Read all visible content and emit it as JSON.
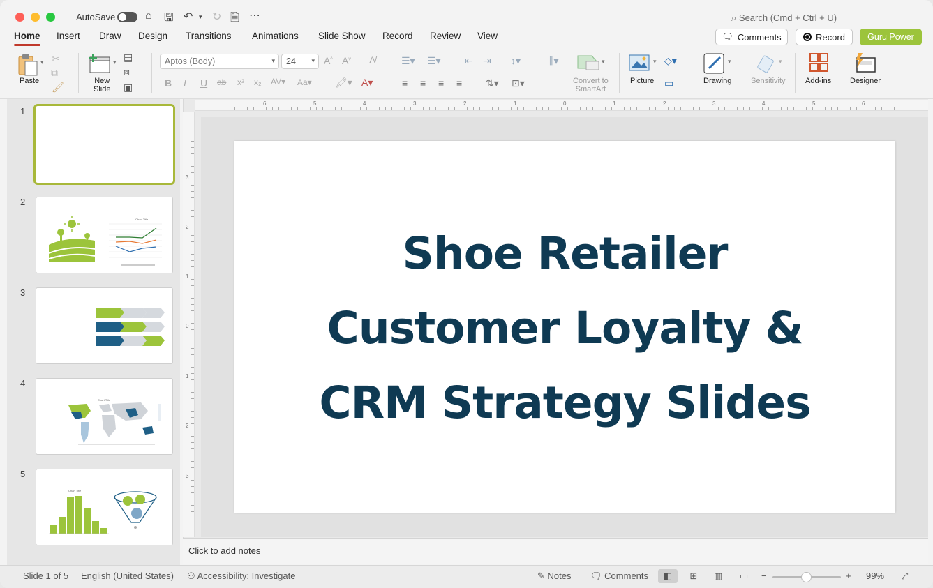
{
  "titlebar": {
    "autosave_label": "AutoSave",
    "search_placeholder": "Search (Cmd + Ctrl + U)"
  },
  "tabs": [
    "Home",
    "Insert",
    "Draw",
    "Design",
    "Transitions",
    "Animations",
    "Slide Show",
    "Record",
    "Review",
    "View"
  ],
  "actions": {
    "comments": "Comments",
    "record": "Record",
    "guru": "Guru Power",
    "guru_color": "#9cc43b"
  },
  "ribbon": {
    "paste": "Paste",
    "new_slide_1": "New",
    "new_slide_2": "Slide",
    "font_name": "Aptos (Body)",
    "font_size": "24",
    "convert_1": "Convert to",
    "convert_2": "SmartArt",
    "picture": "Picture",
    "drawing": "Drawing",
    "sensitivity": "Sensitivity",
    "addins": "Add-ins",
    "designer": "Designer"
  },
  "thumbnails": {
    "numbers": [
      "1",
      "2",
      "3",
      "4",
      "5"
    ],
    "chart_title": "Chart Title"
  },
  "ruler": {
    "h": [
      "6",
      "5",
      "4",
      "3",
      "2",
      "1",
      "0",
      "1",
      "2",
      "3",
      "4",
      "5",
      "6"
    ],
    "v": [
      "3",
      "2",
      "1",
      "0",
      "1",
      "2",
      "3"
    ]
  },
  "slide": {
    "title_line1": "Shoe Retailer",
    "title_line2": "Customer Loyalty &",
    "title_line3": "CRM Strategy Slides",
    "title_color": "#0f3a53"
  },
  "notes_placeholder": "Click to add notes",
  "status": {
    "slide_counter": "Slide 1 of 5",
    "language": "English (United States)",
    "accessibility": "Accessibility: Investigate",
    "notes": "Notes",
    "comments": "Comments",
    "zoom": "99%"
  }
}
